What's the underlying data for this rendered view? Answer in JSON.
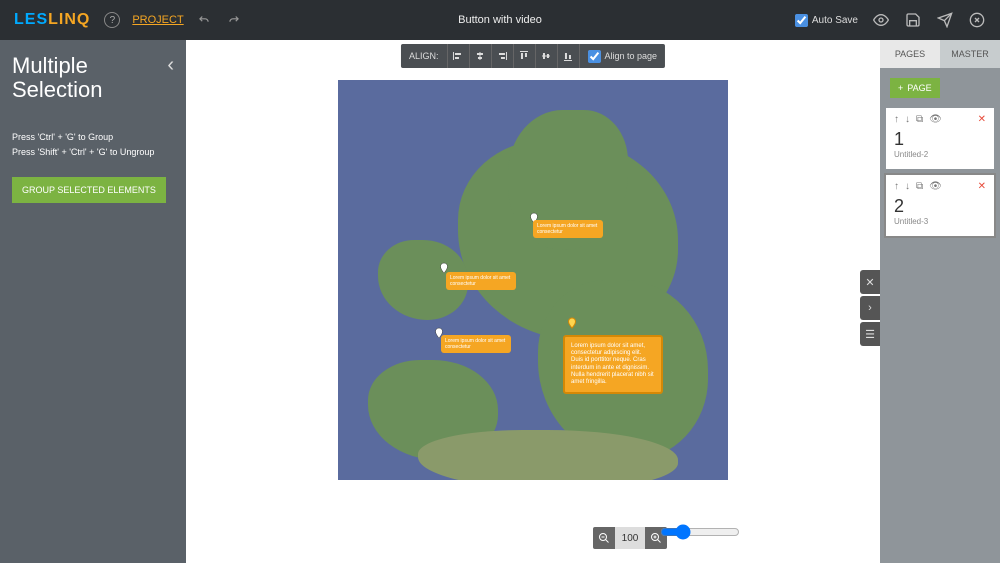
{
  "header": {
    "logo_part1": "LES",
    "logo_part2": "LINQ",
    "project_link": "PROJECT",
    "doc_title": "Button with video",
    "autosave_label": "Auto Save",
    "autosave_checked": true
  },
  "leftpanel": {
    "title_line1": "Multiple",
    "title_line2": "Selection",
    "hint1": "Press 'Ctrl' + 'G' to Group",
    "hint2": "Press 'Shift' + 'Ctrl' + 'G' to Ungroup",
    "button": "GROUP SELECTED ELEMENTS"
  },
  "alignbar": {
    "label": "ALIGN:",
    "align_to_page": "Align to page",
    "align_to_page_checked": true
  },
  "map": {
    "bubble_small_text": "Lorem ipsum dolor sit amet consectetur",
    "bubble_big_text": "Lorem ipsum dolor sit amet, consectetur adipiscing elit. Duis id porttitor neque. Cras interdum in ante et dignissim. Nulla hendrerit placerat nibh sit amet fringilla."
  },
  "zoom": {
    "value": "100"
  },
  "rightpanel": {
    "tab_pages": "PAGES",
    "tab_master": "MASTER",
    "add_page": "PAGE",
    "pages": [
      {
        "num": "1",
        "name": "Untitled-2"
      },
      {
        "num": "2",
        "name": "Untitled-3"
      }
    ]
  }
}
